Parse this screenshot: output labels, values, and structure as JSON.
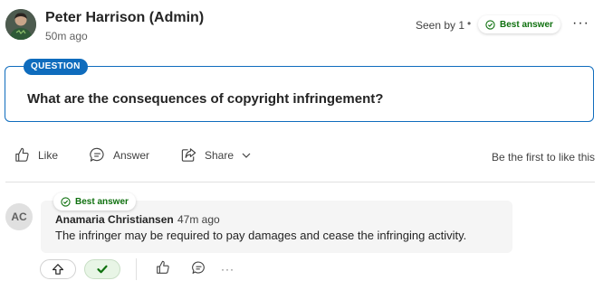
{
  "post": {
    "author": "Peter Harrison (Admin)",
    "time": "50m ago",
    "seen_by": "Seen by 1",
    "separator": "•",
    "best_answer_badge": "Best answer",
    "more": "···"
  },
  "question": {
    "tag": "QUESTION",
    "text": "What are the consequences of copyright infringement?"
  },
  "actions": {
    "like": "Like",
    "answer": "Answer",
    "share": "Share",
    "first_like": "Be the first to like this"
  },
  "answer": {
    "avatar_initials": "AC",
    "badge": "Best answer",
    "author": "Anamaria Christiansen",
    "time": "47m ago",
    "text": "The infringer may be required to pay damages and cease the infringing activity.",
    "more": "···"
  },
  "colors": {
    "accent_blue": "#0f6cbd",
    "best_answer_green": "#0e700e",
    "bubble_bg": "#f5f5f5"
  }
}
